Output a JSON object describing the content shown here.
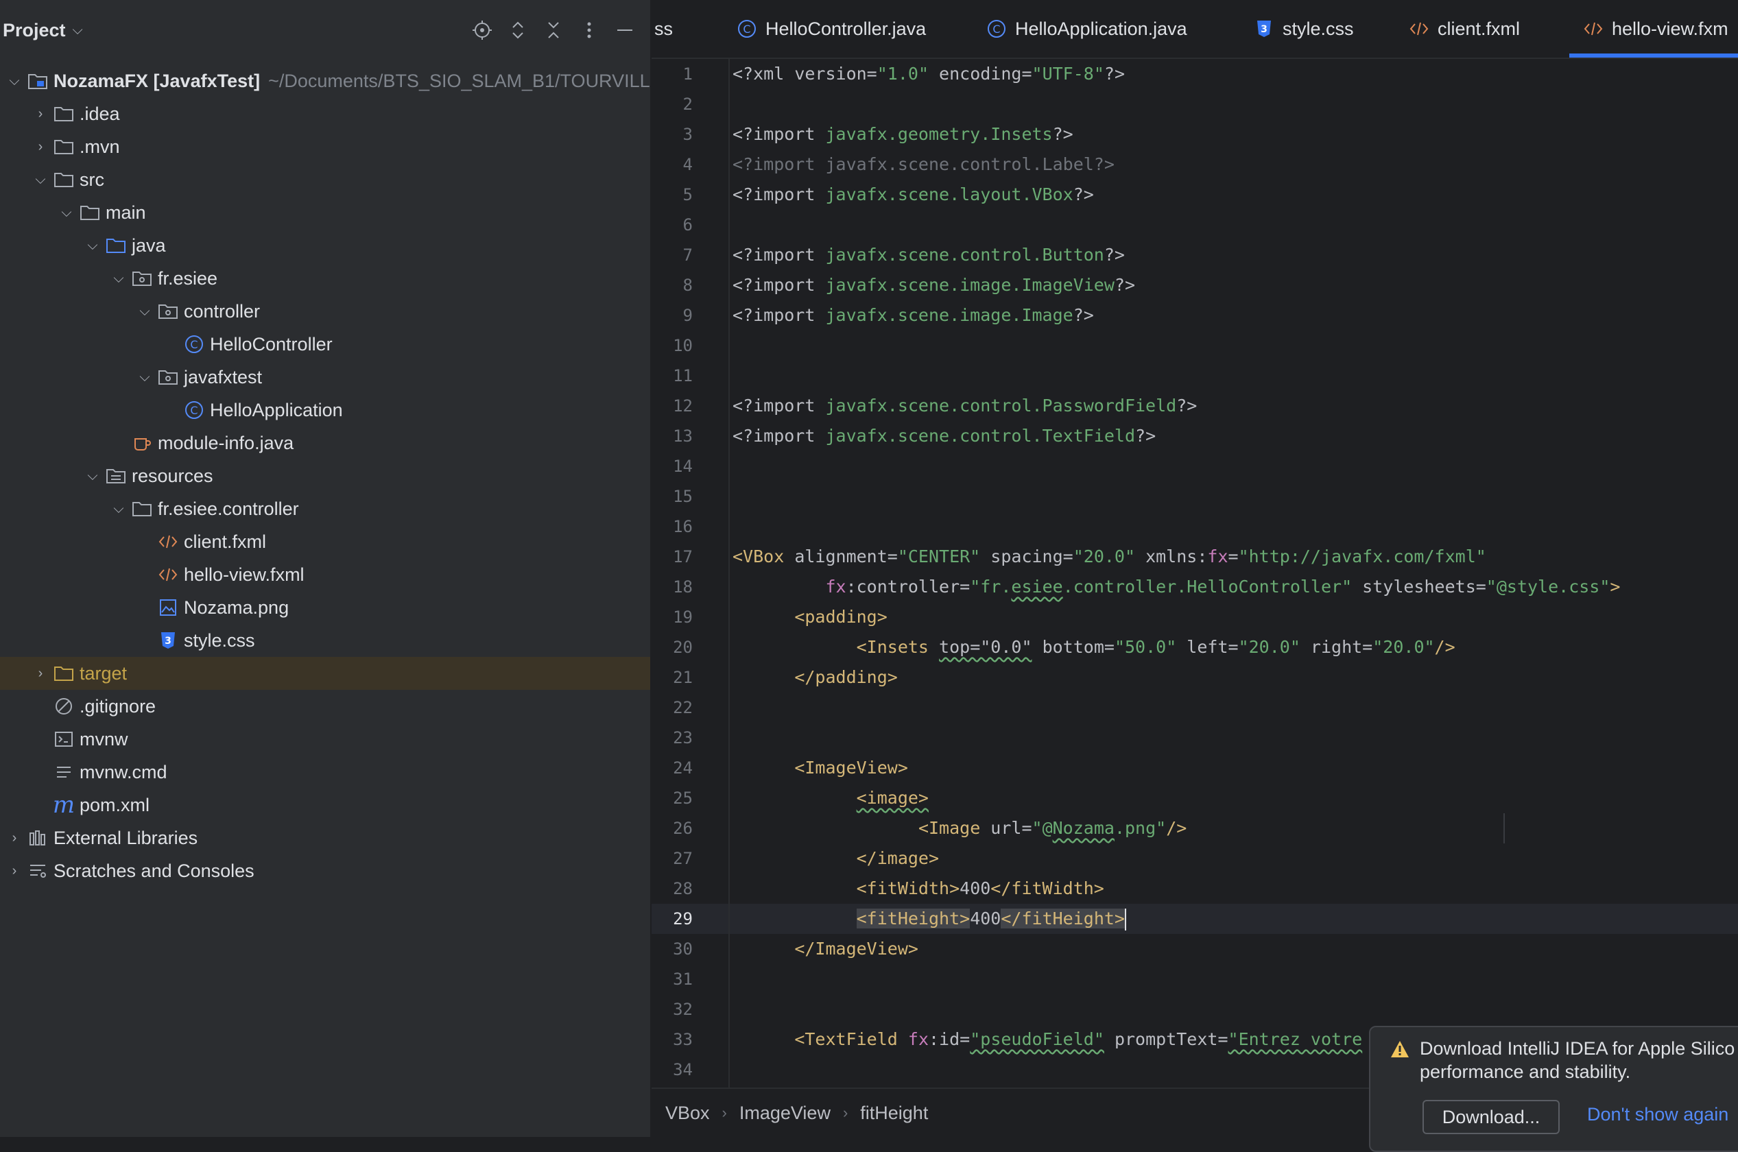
{
  "project_panel": {
    "title": "Project",
    "tree": [
      {
        "label": "NozamaFX [JavafxTest]",
        "hint": "~/Documents/BTS_SIO_SLAM_B1/TOURVILLE",
        "icon": "module-folder-icon"
      },
      {
        "label": ".idea",
        "icon": "folder-icon"
      },
      {
        "label": ".mvn",
        "icon": "folder-icon"
      },
      {
        "label": "src",
        "icon": "folder-icon"
      },
      {
        "label": "main",
        "icon": "folder-icon"
      },
      {
        "label": "java",
        "icon": "source-folder-icon"
      },
      {
        "label": "fr.esiee",
        "icon": "package-icon"
      },
      {
        "label": "controller",
        "icon": "package-icon"
      },
      {
        "label": "HelloController",
        "icon": "java-class-icon"
      },
      {
        "label": "javafxtest",
        "icon": "package-icon"
      },
      {
        "label": "HelloApplication",
        "icon": "java-class-icon"
      },
      {
        "label": "module-info.java",
        "icon": "java-module-icon"
      },
      {
        "label": "resources",
        "icon": "resources-folder-icon"
      },
      {
        "label": "fr.esiee.controller",
        "icon": "folder-icon"
      },
      {
        "label": "client.fxml",
        "icon": "fxml-icon"
      },
      {
        "label": "hello-view.fxml",
        "icon": "fxml-icon"
      },
      {
        "label": "Nozama.png",
        "icon": "image-file-icon"
      },
      {
        "label": "style.css",
        "icon": "css-file-icon"
      },
      {
        "label": "target",
        "icon": "excluded-folder-icon"
      },
      {
        "label": ".gitignore",
        "icon": "ignore-file-icon"
      },
      {
        "label": "mvnw",
        "icon": "shell-script-icon"
      },
      {
        "label": "mvnw.cmd",
        "icon": "text-file-icon"
      },
      {
        "label": "pom.xml",
        "icon": "maven-icon"
      },
      {
        "label": "External Libraries",
        "icon": "libraries-icon"
      },
      {
        "label": "Scratches and Consoles",
        "icon": "scratches-icon"
      }
    ]
  },
  "tabs": [
    {
      "label": "ss",
      "icon": ""
    },
    {
      "label": "HelloController.java",
      "icon": "java-class-icon"
    },
    {
      "label": "HelloApplication.java",
      "icon": "java-class-icon"
    },
    {
      "label": "style.css",
      "icon": "css-file-icon"
    },
    {
      "label": "client.fxml",
      "icon": "fxml-icon"
    },
    {
      "label": "hello-view.fxm",
      "icon": "fxml-icon",
      "active": true
    }
  ],
  "editor": {
    "line_numbers": [
      "1",
      "2",
      "3",
      "4",
      "5",
      "6",
      "7",
      "8",
      "9",
      "10",
      "11",
      "12",
      "13",
      "14",
      "15",
      "16",
      "17",
      "18",
      "19",
      "20",
      "21",
      "22",
      "23",
      "24",
      "25",
      "26",
      "27",
      "28",
      "29",
      "30",
      "31",
      "32",
      "33",
      "34"
    ],
    "current_line": "29",
    "code": {
      "l1_a": "<?xml ",
      "l1_b": "version",
      "l1_c": "=",
      "l1_d": "\"1.0\"",
      "l1_e": " encoding",
      "l1_f": "=",
      "l1_g": "\"UTF-8\"",
      "l1_h": "?>",
      "l3_a": "<?import ",
      "l3_b": "javafx.geometry.Insets",
      "l3_c": "?>",
      "l4": "<?import javafx.scene.control.Label?>",
      "l5_a": "<?import ",
      "l5_b": "javafx.scene.layout.VBox",
      "l5_c": "?>",
      "l7_a": "<?import ",
      "l7_b": "javafx.scene.control.Button",
      "l7_c": "?>",
      "l8_a": "<?import ",
      "l8_b": "javafx.scene.image.ImageView",
      "l8_c": "?>",
      "l9_a": "<?import ",
      "l9_b": "javafx.scene.image.Image",
      "l9_c": "?>",
      "l12_a": "<?import ",
      "l12_b": "javafx.scene.control.PasswordField",
      "l12_c": "?>",
      "l13_a": "<?import ",
      "l13_b": "javafx.scene.control.TextField",
      "l13_c": "?>",
      "l17_a": "<VBox ",
      "l17_b": "alignment=",
      "l17_c": "\"CENTER\"",
      "l17_d": " spacing=",
      "l17_e": "\"20.0\"",
      "l17_f": " xmlns:",
      "l17_g": "fx",
      "l17_h": "=",
      "l17_i": "\"http://javafx.com/fxml\"",
      "l18_a": "fx",
      "l18_b": ":controller=",
      "l18_c": "\"fr.",
      "l18_d": "esiee",
      "l18_e": ".controller.HelloController\"",
      "l18_f": " stylesheets=",
      "l18_g": "\"@style.css\"",
      "l18_h": ">",
      "l19": "<padding>",
      "l20_a": "<Insets ",
      "l20_b": "top=\"0.0\"",
      "l20_c": " bottom=",
      "l20_d": "\"50.0\"",
      "l20_e": " left=",
      "l20_f": "\"20.0\"",
      "l20_g": " right=",
      "l20_h": "\"20.0\"",
      "l20_i": "/>",
      "l21": "</padding>",
      "l24": "<ImageView>",
      "l25": "<image>",
      "l26_a": "<Image ",
      "l26_b": "url=",
      "l26_c": "\"@",
      "l26_d": "Nozama",
      "l26_e": ".png\"",
      "l26_f": "/>",
      "l27": "</image>",
      "l28_a": "<fitWidth>",
      "l28_b": "400",
      "l28_c": "</fitWidth>",
      "l29_a": "<fitHeight>",
      "l29_b": "400",
      "l29_c": "</fitHeight>",
      "l30": "</ImageView>",
      "l33_a": "<TextField ",
      "l33_b": "fx",
      "l33_c": ":id=",
      "l33_d": "\"pseudoField\"",
      "l33_e": " promptText=",
      "l33_f": "\"Entrez votre"
    }
  },
  "breadcrumb": [
    "VBox",
    "ImageView",
    "fitHeight"
  ],
  "notification": {
    "text_line1": "Download IntelliJ IDEA for Apple Silico",
    "text_line2": "performance and stability.",
    "button": "Download...",
    "link": "Don't show again"
  },
  "colors": {
    "accent": "#3574f0",
    "tag": "#d5b778",
    "string": "#6aab73",
    "namespace": "#c77dbb"
  }
}
